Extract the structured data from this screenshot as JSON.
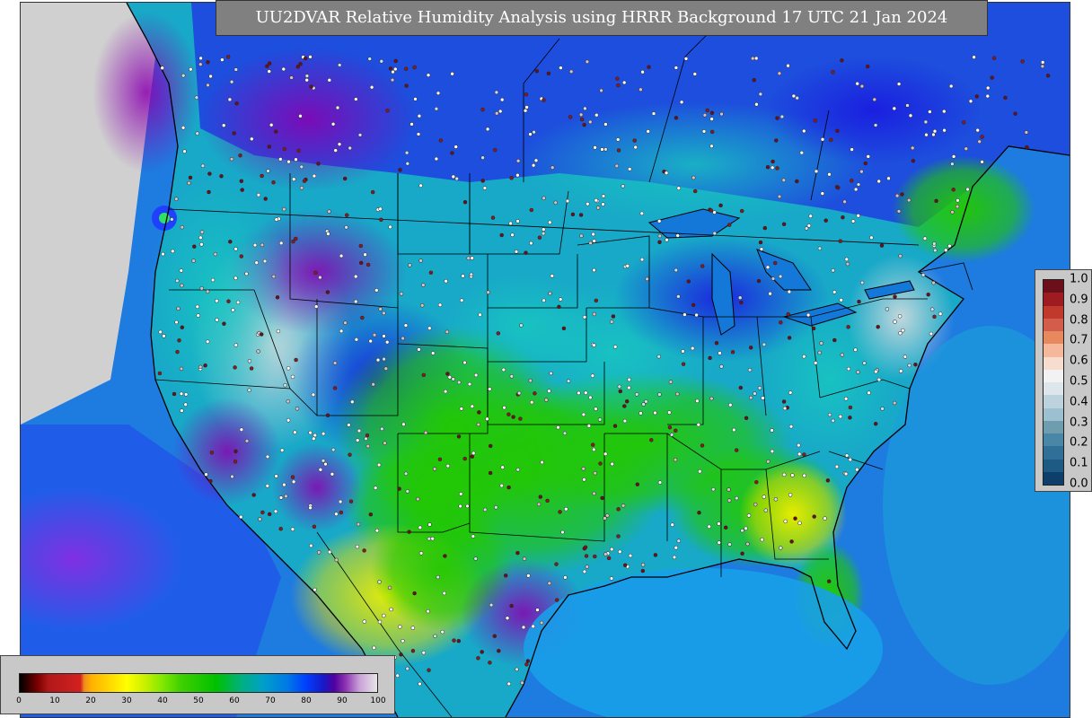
{
  "title": "UU2DVAR Relative Humidity Analysis using HRRR Background 17 UTC 21 Jan 2024",
  "obs_legend": {
    "ticks": [
      "1.0",
      "0.9",
      "0.8",
      "0.7",
      "0.6",
      "0.5",
      "0.4",
      "0.3",
      "0.2",
      "0.1",
      "0.0"
    ],
    "colors": [
      "#6b0f1a",
      "#9e1b22",
      "#c0392b",
      "#d35d4a",
      "#e8885e",
      "#f5b89a",
      "#f7ddd0",
      "#f2f2f2",
      "#dde6ea",
      "#bcd3de",
      "#9cc0cf",
      "#6e9db0",
      "#4a86a6",
      "#2f6f98",
      "#1d5a84",
      "#0e3f6a"
    ]
  },
  "rh_legend": {
    "ticks": [
      "0",
      "10",
      "20",
      "30",
      "40",
      "50",
      "60",
      "70",
      "80",
      "90",
      "100"
    ]
  },
  "colors": {
    "ocean": "#1e7be0",
    "land_base": "#18a8c8",
    "outside": "#d0d0d0",
    "border": "#000000"
  }
}
